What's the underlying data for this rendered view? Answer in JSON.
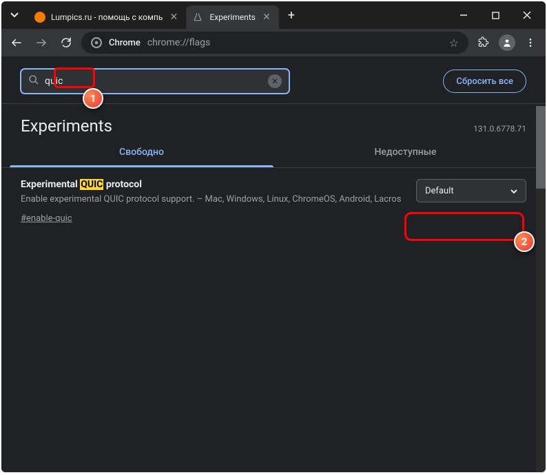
{
  "tabs": {
    "first": {
      "title": "Lumpics.ru - помощь с компь"
    },
    "second": {
      "title": "Experiments"
    }
  },
  "addressbar": {
    "chrome_label": "Chrome",
    "url": "chrome://flags"
  },
  "search": {
    "value": "quic",
    "reset_btn": "Сбросить все"
  },
  "page": {
    "title": "Experiments",
    "version": "131.0.6778.71"
  },
  "page_tabs": {
    "available": "Свободно",
    "unavailable": "Недоступные"
  },
  "flag": {
    "title_prefix": "Experimental",
    "title_highlight": "QUIC",
    "title_suffix": "protocol",
    "description": "Enable experimental QUIC protocol support. – Mac, Windows, Linux, ChromeOS, Android, Lacros",
    "link": "#enable-quic",
    "select_value": "Default"
  },
  "annotations": {
    "badge1": "1",
    "badge2": "2"
  }
}
